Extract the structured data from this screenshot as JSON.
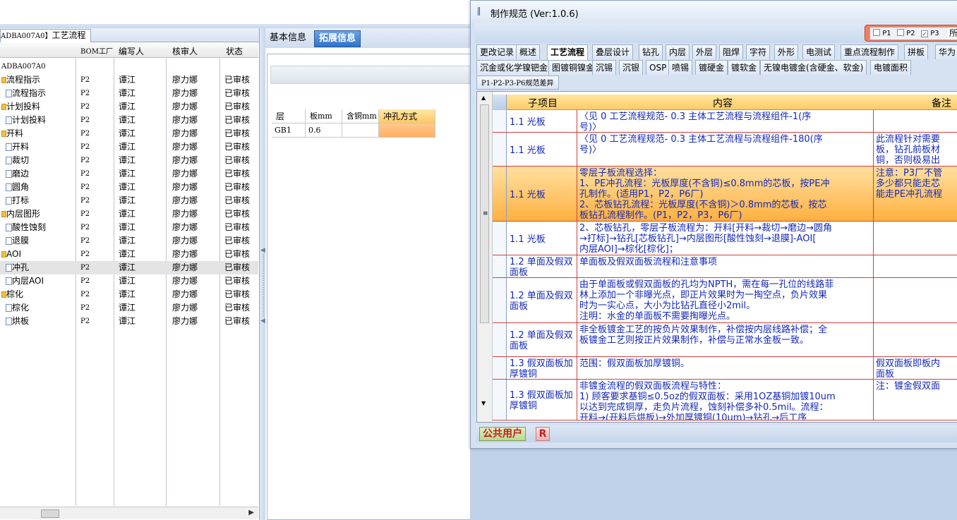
{
  "left": {
    "tab_code": "ADBA007A0】",
    "tab_label": "工艺流程",
    "headers": [
      "BOM工厂",
      "编写人",
      "核审人",
      "状态"
    ],
    "root": "ADBA007A0",
    "rows": [
      {
        "level": 1,
        "name": "流程指示",
        "bom": "P2",
        "writer": "谭江",
        "reviewer": "廖力娜",
        "status": "已审核"
      },
      {
        "level": 2,
        "name": "流程指示",
        "bom": "P2",
        "writer": "谭江",
        "reviewer": "廖力娜",
        "status": "已审核"
      },
      {
        "level": 1,
        "name": "计划投料",
        "bom": "P2",
        "writer": "谭江",
        "reviewer": "廖力娜",
        "status": "已审核"
      },
      {
        "level": 2,
        "name": "计划投料",
        "bom": "P2",
        "writer": "谭江",
        "reviewer": "廖力娜",
        "status": "已审核"
      },
      {
        "level": 1,
        "name": "开料",
        "bom": "P2",
        "writer": "谭江",
        "reviewer": "廖力娜",
        "status": "已审核"
      },
      {
        "level": 2,
        "name": "开料",
        "bom": "P2",
        "writer": "谭江",
        "reviewer": "廖力娜",
        "status": "已审核"
      },
      {
        "level": 2,
        "name": "裁切",
        "bom": "P2",
        "writer": "谭江",
        "reviewer": "廖力娜",
        "status": "已审核"
      },
      {
        "level": 2,
        "name": "磨边",
        "bom": "P2",
        "writer": "谭江",
        "reviewer": "廖力娜",
        "status": "已审核"
      },
      {
        "level": 2,
        "name": "圆角",
        "bom": "P2",
        "writer": "谭江",
        "reviewer": "廖力娜",
        "status": "已审核"
      },
      {
        "level": 2,
        "name": "打标",
        "bom": "P2",
        "writer": "谭江",
        "reviewer": "廖力娜",
        "status": "已审核"
      },
      {
        "level": 1,
        "name": "内层图形",
        "bom": "P2",
        "writer": "谭江",
        "reviewer": "廖力娜",
        "status": "已审核"
      },
      {
        "level": 2,
        "name": "酸性蚀刻",
        "bom": "P2",
        "writer": "谭江",
        "reviewer": "廖力娜",
        "status": "已审核"
      },
      {
        "level": 2,
        "name": "退膜",
        "bom": "P2",
        "writer": "谭江",
        "reviewer": "廖力娜",
        "status": "已审核"
      },
      {
        "level": 1,
        "name": "AOI",
        "bom": "P2",
        "writer": "谭江",
        "reviewer": "廖力娜",
        "status": "已审核"
      },
      {
        "level": 2,
        "name": "冲孔",
        "bom": "P2",
        "writer": "谭江",
        "reviewer": "廖力娜",
        "status": "已审核",
        "selected": true
      },
      {
        "level": 2,
        "name": "内层AOI",
        "bom": "P2",
        "writer": "谭江",
        "reviewer": "廖力娜",
        "status": "已审核"
      },
      {
        "level": 1,
        "name": "棕化",
        "bom": "P2",
        "writer": "谭江",
        "reviewer": "廖力娜",
        "status": "已审核"
      },
      {
        "level": 2,
        "name": "棕化",
        "bom": "P2",
        "writer": "谭江",
        "reviewer": "廖力娜",
        "status": "已审核"
      },
      {
        "level": 2,
        "name": "烘板",
        "bom": "P2",
        "writer": "谭江",
        "reviewer": "廖力娜",
        "status": "已审核"
      }
    ]
  },
  "middle": {
    "tab_basic": "基本信息",
    "tab_ext": "拓展信息",
    "grid_headers": [
      "层",
      "板mm",
      "含铜mm",
      "冲孔方式"
    ],
    "grid_row": [
      "GB1",
      "0.6",
      "",
      ""
    ]
  },
  "window": {
    "title": "制作规范 (Ver:1.0.6)",
    "filters": [
      {
        "label": "P1",
        "checked": false
      },
      {
        "label": "P2",
        "checked": false
      },
      {
        "label": "P3",
        "checked": true
      },
      {
        "label": "所",
        "checked": false
      }
    ],
    "tabs_row1": [
      "更改记录",
      "概述",
      "工艺流程",
      "叠层设计",
      "钻孔",
      "内层",
      "外层",
      "阻焊",
      "字符",
      "外形",
      "电测试",
      "重点流程制作",
      "拼板",
      "华为"
    ],
    "active_tab": "工艺流程",
    "tabs_row2": [
      "沉金或化学镍钯金",
      "图镀铜镍金",
      "沉锡",
      "沉银",
      "OSP",
      "喷锡",
      "镀硬金",
      "镀软金",
      "无镍电镀金(含硬金、软金)",
      "电镀面积"
    ],
    "subtab": "P1-P2-P3-P6规范差异",
    "table_headers": [
      "子项目",
      "内容",
      "备注"
    ],
    "rows": [
      {
        "sub": "1.1 光板",
        "content": [
          "〈见 0 工艺流程规范- 0.3 主体工艺流程与流程组件-1(序",
          "号)〉"
        ],
        "note": ""
      },
      {
        "sub": "1.1 光板",
        "content": [
          "〈见 0 工艺流程规范- 0.3 主体工艺流程与流程组件-180(序",
          "号)〉"
        ],
        "note": "此流程针对需要\n板，钻孔前板材\n铜，否则极易出"
      },
      {
        "sub": "1.1 光板",
        "content": [
          "零层子板流程选择：",
          "1、PE冲孔流程：光板厚度(不含铜)≤0.8mm的芯板，按PE冲",
          "孔制作。(适用P1，P2，P6厂)",
          "2、芯板钻孔流程：光板厚度(不含铜)＞0.8mm的芯板，按芯",
          "板钻孔流程制作。(P1，P2，P3，P6厂)"
        ],
        "note": "注意：P3厂不管\n多少都只能走芯\n能走PE冲孔流程",
        "highlight": true
      },
      {
        "sub": "1.1 光板",
        "content": [
          "2、芯板钻孔，零层子板流程为：开料[开料→裁切→磨边→圆角",
          "→打标]→钻孔[芯板钻孔]→内层图形[酸性蚀刻→退膜]-AOI[",
          "内层AOI]→棕化[棕化]；"
        ],
        "note": ""
      },
      {
        "sub": "1.2 单面及假双面板",
        "content": [
          "单面板及假双面板流程和注意事项"
        ],
        "note": ""
      },
      {
        "sub": "1.2 单面及假双面板",
        "content": [
          "由于单面板或假双面板的孔均为NPTH，需在每一孔位的线路菲",
          "林上添加一个非曝光点，即正片效果时为一掏空点，负片效果",
          "时为一实心点，大小为比钻孔直径小2mil。",
          "注明：水金的单面板不需要掏曝光点。"
        ],
        "note": ""
      },
      {
        "sub": "1.2 单面及假双面板",
        "content": [
          "非全板镀金工艺的按负片效果制作，补偿按内层线路补偿；全",
          "板镀金工艺则按正片效果制作，补偿与正常水金板一致。"
        ],
        "note": ""
      },
      {
        "sub": "1.3 假双面板加厚镀铜",
        "content": [
          "范围：假双面板加厚镀铜。"
        ],
        "note": "假双面板即板内\n面板"
      },
      {
        "sub": "1.3 假双面板加厚镀铜",
        "content": [
          "非镀金流程的假双面板流程与特性：",
          "1) 顾客要求基铜≤0.5oz的假双面板：采用1OZ基铜加镀10um",
          "以达到完成铜厚，走负片流程，蚀刻补偿多补0.5mil。流程：",
          "开料→(开料后烘板)→外加厚镀铜(10um)→钻孔→后工序"
        ],
        "note": "注：镀金假双面"
      }
    ],
    "status_user": "公共用户",
    "status_r": "R"
  }
}
